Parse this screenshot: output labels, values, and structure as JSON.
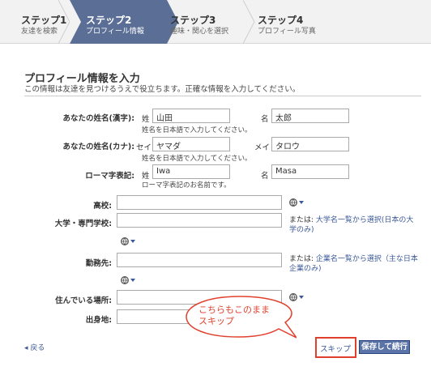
{
  "steps": [
    {
      "title": "ステップ1",
      "subtitle": "友達を検索"
    },
    {
      "title": "ステップ2",
      "subtitle": "プロフィール情報"
    },
    {
      "title": "ステップ3",
      "subtitle": "趣味・関心を選択"
    },
    {
      "title": "ステップ4",
      "subtitle": "プロフィール写真"
    }
  ],
  "form": {
    "title": "プロフィール情報を入力",
    "subtitle": "この情報は友達を見つけるうえで役立ちます。正確な情報を入力してください。",
    "kanji": {
      "label": "あなたの姓名(漢字):",
      "last_label": "姓",
      "last_value": "山田",
      "first_label": "名",
      "first_value": "太郎",
      "hint": "姓名を日本語で入力してください。"
    },
    "kana": {
      "label": "あなたの姓名(カナ):",
      "last_label": "セイ",
      "last_value": "ヤマダ",
      "first_label": "メイ",
      "first_value": "タロウ",
      "hint": "姓名を日本語で入力してください。"
    },
    "roman": {
      "label": "ローマ字表記:",
      "last_label": "姓",
      "last_value": "Iwa",
      "first_label": "名",
      "first_value": "Masa",
      "hint": "ローマ字表記のお名前です。"
    },
    "highschool": {
      "label": "高校:",
      "value": ""
    },
    "university": {
      "label": "大学・専門学校:",
      "value": "",
      "or": "または:",
      "link": "大学名一覧から選択(日本の大学のみ)"
    },
    "workplace": {
      "label": "勤務先:",
      "value": "",
      "or": "または:",
      "link": "企業名一覧から選択（主な日本企業のみ)"
    },
    "residence": {
      "label": "住んでいる場所:",
      "value": ""
    },
    "hometown": {
      "label": "出身地:",
      "value": ""
    }
  },
  "callout": {
    "text": "こちらもこのまま\nスキップ",
    "color": "#e0412f"
  },
  "footer": {
    "back": "戻る",
    "skip": "スキップ",
    "save": "保存して続行"
  },
  "icons": {
    "privacy": "globe-icon",
    "dropdown": "chevron-down-icon",
    "back": "caret-left-icon"
  },
  "colors": {
    "accent": "#5b6f96",
    "link": "#3b5998",
    "annotation": "#e0412f"
  }
}
